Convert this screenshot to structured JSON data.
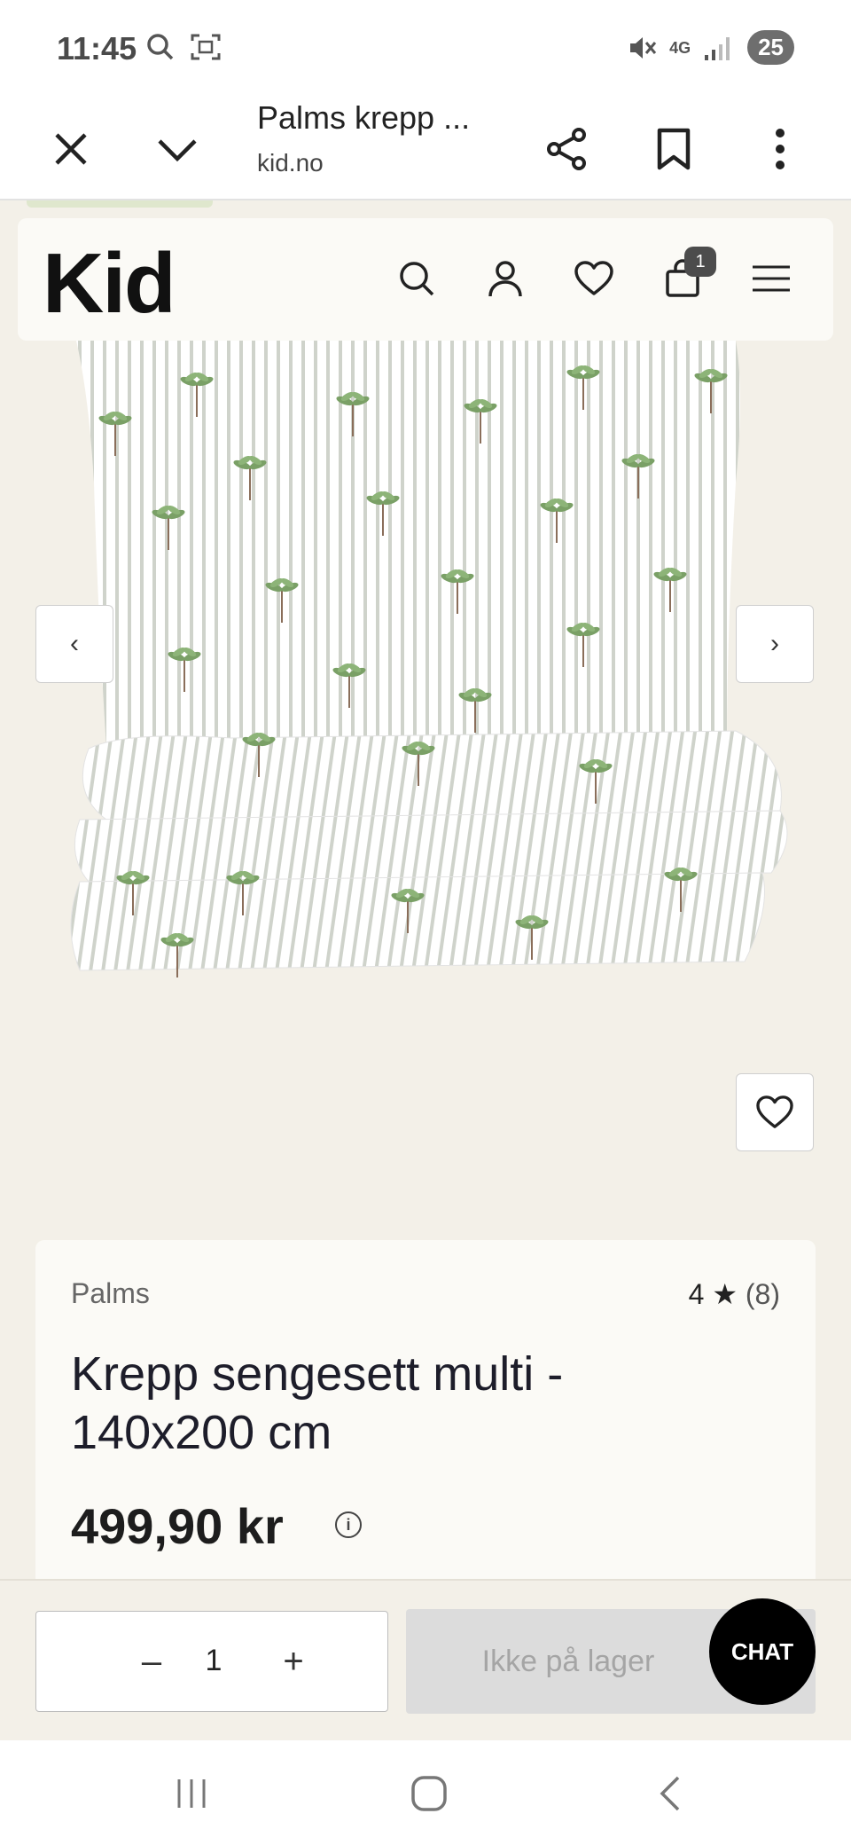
{
  "status_bar": {
    "time": "11:45",
    "network": "4G",
    "battery": "25"
  },
  "browser": {
    "tab_title": "Palms krepp ...",
    "url": "kid.no"
  },
  "site": {
    "logo": "Kid",
    "cart_count": "1"
  },
  "product": {
    "brand": "Palms",
    "rating": "4 ★",
    "review_count": "(8)",
    "title": "Krepp sengesett multi - 140x200 cm",
    "price": "499,90 kr",
    "info": "i"
  },
  "gallery": {
    "prev": "‹",
    "next": "›"
  },
  "actions": {
    "qty_minus": "–",
    "qty_value": "1",
    "qty_plus": "+",
    "stock_status": "Ikke på lager",
    "chat": "CHAT"
  },
  "colors": {
    "page_bg": "#f3f0e8",
    "card_bg": "#fbfaf6",
    "palm_green": "#7aa066"
  }
}
